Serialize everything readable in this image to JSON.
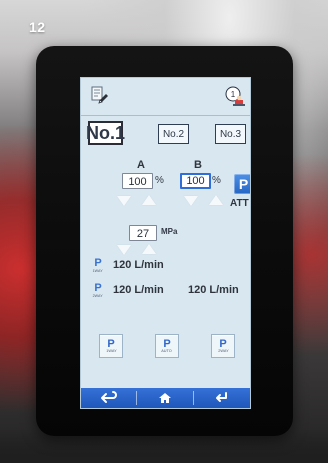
{
  "page_label": "12",
  "header": {
    "left_icon": "hydraulic-settings-icon",
    "right_icon": "user-alert-icon",
    "right_badge": "1"
  },
  "profiles": {
    "active": "No.1",
    "second": "No.2",
    "third": "No.3"
  },
  "channels": {
    "a_label": "A",
    "b_label": "B",
    "a_value": "100",
    "b_value": "100",
    "a_unit": "%",
    "b_unit": "%",
    "att_symbol": "P",
    "att_label": "ATT"
  },
  "pressure": {
    "value": "27",
    "unit": "MPa"
  },
  "flows": {
    "row1_symbol": "P",
    "row1_icon_text": "1WAY",
    "row1_value": "120 L/min",
    "row2_symbol": "P",
    "row2_icon_text": "2WAY",
    "row2_value_1": "120 L/min",
    "row2_value_2": "120 L/min"
  },
  "mode_buttons": [
    {
      "symbol": "P",
      "text": "1WAY"
    },
    {
      "symbol": "P",
      "text": "AUTO"
    },
    {
      "symbol": "P",
      "text": "2WAY"
    }
  ],
  "bottom_nav": {
    "back_icon": "back-arrow-icon",
    "home_icon": "home-icon",
    "enter_icon": "enter-icon"
  },
  "colors": {
    "accent": "#2f6dd9",
    "screen_bg": "#d9e7f0",
    "bottom_bar": "#2b63c8"
  }
}
